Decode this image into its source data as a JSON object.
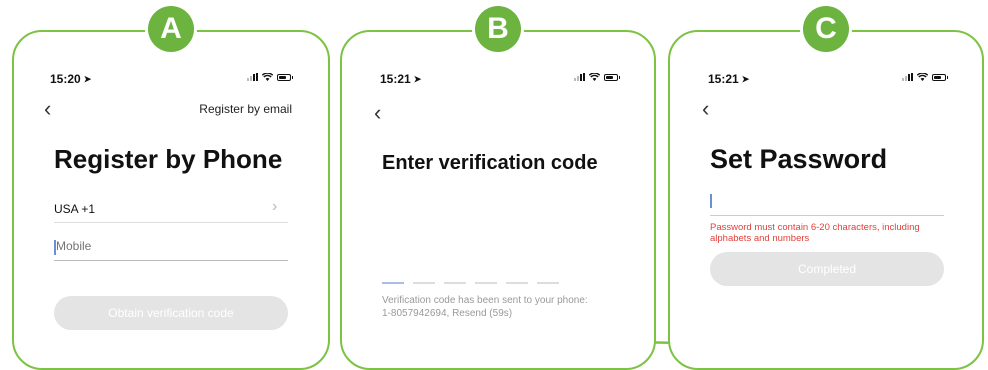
{
  "colors": {
    "accent_green": "#6cb33f",
    "panel_border": "#7cc243",
    "error_red": "#e0413a"
  },
  "badges": {
    "a": "A",
    "b": "B",
    "c": "C"
  },
  "panel_a": {
    "time": "15:20",
    "register_by_email": "Register by email",
    "title": "Register by Phone",
    "country": "USA +1",
    "mobile_placeholder": "Mobile",
    "obtain_button": "Obtain verification code"
  },
  "panel_b": {
    "time": "15:21",
    "title": "Enter verification code",
    "code_slots": 6,
    "sent_line1": "Verification code has been sent to your phone:",
    "sent_line2": "1-8057942694, Resend (59s)"
  },
  "panel_c": {
    "time": "15:21",
    "title": "Set Password",
    "error_line1": "Password must contain 6-20 characters, including",
    "error_line2": "alphabets and numbers",
    "completed_button": "Completed"
  }
}
